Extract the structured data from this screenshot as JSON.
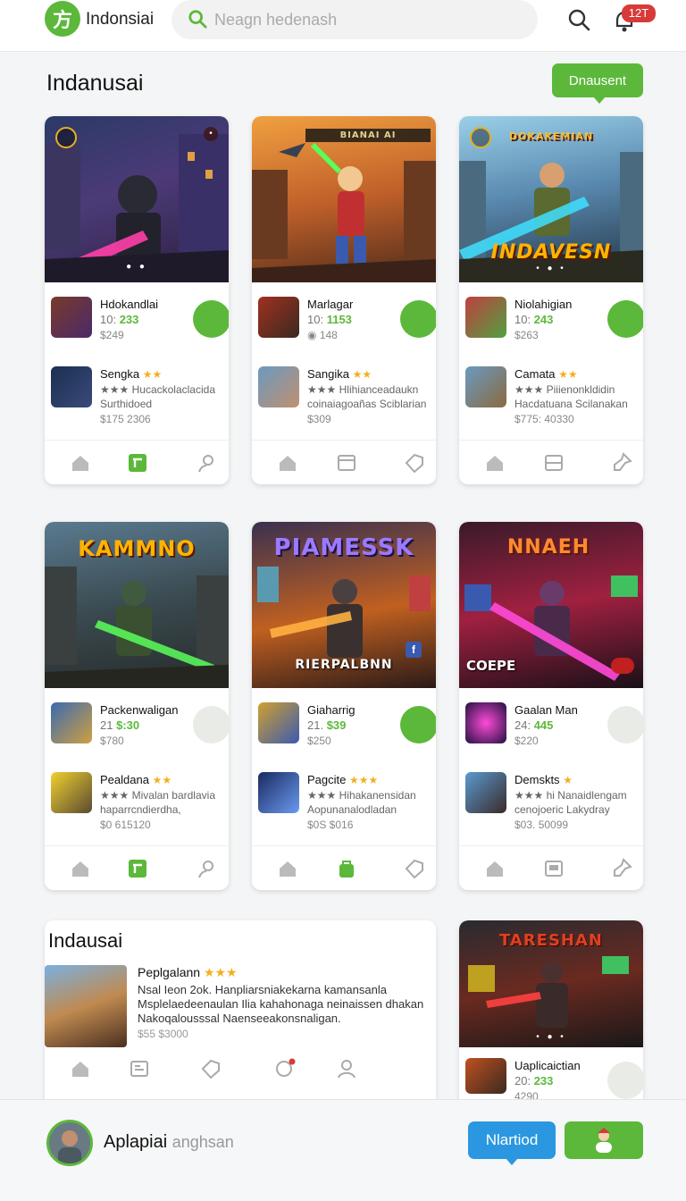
{
  "header": {
    "logo_glyph": "方",
    "title": "Indonsiai",
    "search_placeholder": "Neagn hedenash",
    "notification_count": "12T"
  },
  "section1": {
    "title": "Indanusai",
    "tooltip_button": "Dnausent"
  },
  "cards": [
    {
      "hero_title": "",
      "hero_sub": "",
      "items": [
        {
          "name": "Hdokandlai",
          "meta_a": "10:",
          "meta_b": "233",
          "price": "$249"
        },
        {
          "name": "Sengka",
          "stars": "★★",
          "desc1": "★★★ Hucackolaclacida",
          "desc2": "Surthidoed",
          "price": "$175 2306"
        }
      ]
    },
    {
      "hero_title": "BIANAI AI",
      "hero_sub": "",
      "items": [
        {
          "name": "Marlagar",
          "meta_a": "10:",
          "meta_b": "1153",
          "price": "148"
        },
        {
          "name": "Sangika",
          "stars": "★★",
          "desc1": "★★★ Hlihianceadaukn",
          "desc2": "coinaiagoañas Sciblarian",
          "price": "$309"
        }
      ]
    },
    {
      "hero_title": "DOKAKEMIAN",
      "hero_sub": "INDAVESN",
      "items": [
        {
          "name": "Niolahigian",
          "meta_a": "10:",
          "meta_b": "243",
          "price": "$263"
        },
        {
          "name": "Camata",
          "stars": "★★",
          "desc1": "★★★ Piiienonkldidin",
          "desc2": "Hacdatuana Scilanakan",
          "price": "$775: 40330"
        }
      ]
    },
    {
      "hero_title": "KAMMNO",
      "hero_sub": "",
      "items": [
        {
          "name": "Packenwaligan",
          "meta_a": "21",
          "meta_b": "$:30",
          "price": "$780"
        },
        {
          "name": "Pealdana",
          "stars": "★★",
          "desc1": "★★★ Mivalan bardlavia",
          "desc2": "haparrcndierdha,",
          "price": "$0 615120"
        }
      ]
    },
    {
      "hero_title": "PIAMESSK",
      "hero_sub": "RIERPALBNN",
      "items": [
        {
          "name": "Giaharrig",
          "meta_a": "21.",
          "meta_b": "$39",
          "price": "$250"
        },
        {
          "name": "Pagcite",
          "stars": "★★★",
          "desc1": "★★★ Hihakanensidan",
          "desc2": "Aopunanalodladan",
          "price": "$0S $016"
        }
      ]
    },
    {
      "hero_title": "NNAEH",
      "hero_sub": "COEPE",
      "items": [
        {
          "name": "Gaalan Man",
          "meta_a": "24:",
          "meta_b": "445",
          "price": "$220"
        },
        {
          "name": "Demskts",
          "stars": "★",
          "desc1": "★★★ hi Nanaidlengam",
          "desc2": "cenojoeric Lakydray",
          "price": "$03. 50099"
        }
      ]
    }
  ],
  "wide": {
    "title": "Indausai",
    "item_name": "Peplgalann",
    "item_stars": "★★★",
    "line1": "Nsal Ieon 2ok. Hanpliarsniakekarna kamansanla",
    "line2": "Msplelaedeenaulan Ilia kahahonaga neinaissen dhakan",
    "line3": "Nakoqalousssal Naenseeakonsnaligan.",
    "price": "$55 $3000"
  },
  "side": {
    "hero_title": "TARESHAN",
    "item_name": "Uaplicaictian",
    "meta_a": "20:",
    "meta_b": "233",
    "price": "4290"
  },
  "bottombar": {
    "user_name": "Aplapiai",
    "user_sub": "anghsan",
    "blue_button": "Nlartiod"
  },
  "colors": {
    "accent": "#5cb83a",
    "blue": "#2a97e0",
    "star": "#f2b01e"
  }
}
